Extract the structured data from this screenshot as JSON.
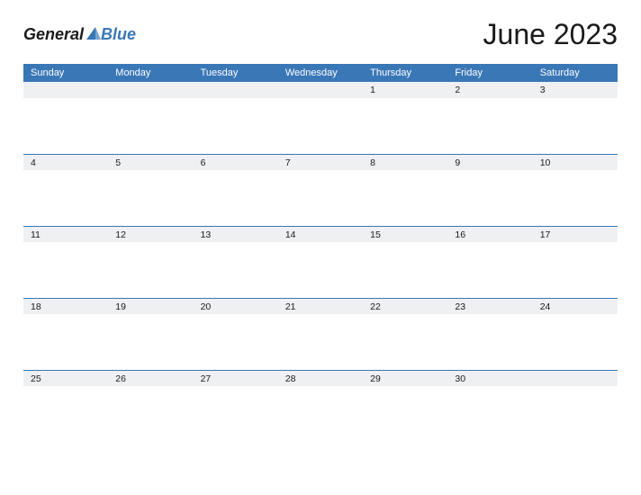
{
  "logo": {
    "word1": "General",
    "word2": "Blue"
  },
  "title": "June 2023",
  "day_names": [
    "Sunday",
    "Monday",
    "Tuesday",
    "Wednesday",
    "Thursday",
    "Friday",
    "Saturday"
  ],
  "weeks": [
    [
      "",
      "",
      "",
      "",
      "1",
      "2",
      "3"
    ],
    [
      "4",
      "5",
      "6",
      "7",
      "8",
      "9",
      "10"
    ],
    [
      "11",
      "12",
      "13",
      "14",
      "15",
      "16",
      "17"
    ],
    [
      "18",
      "19",
      "20",
      "21",
      "22",
      "23",
      "24"
    ],
    [
      "25",
      "26",
      "27",
      "28",
      "29",
      "30",
      ""
    ]
  ]
}
